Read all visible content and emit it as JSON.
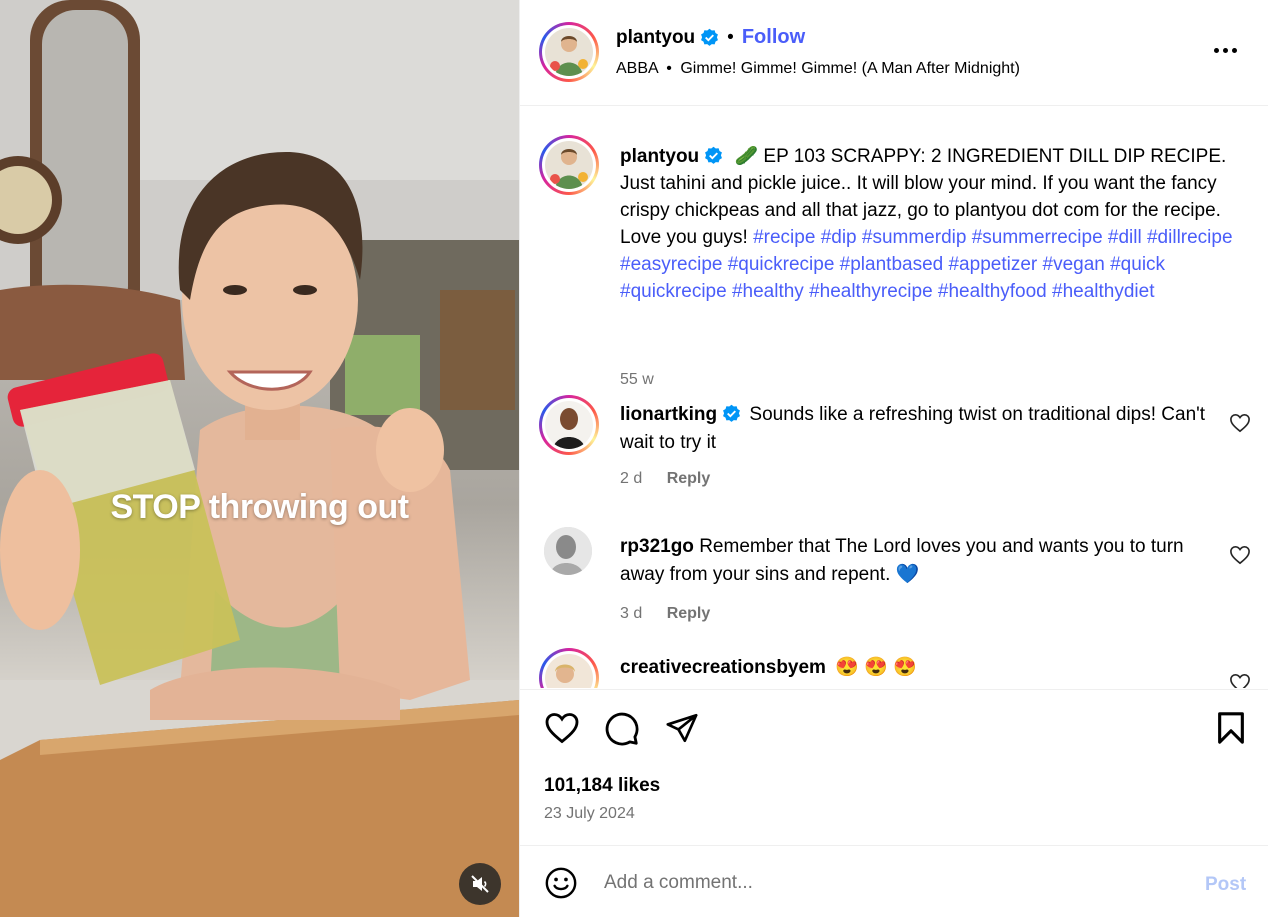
{
  "media": {
    "overlay_text": "STOP throwing out"
  },
  "header": {
    "username": "plantyou",
    "separator": "•",
    "follow_label": "Follow",
    "audio_artist": "ABBA",
    "audio_separator": "•",
    "audio_title": "Gimme! Gimme! Gimme! (A Man After Midnight)"
  },
  "caption": {
    "username": "plantyou",
    "emoji": "🥒",
    "text": "EP 103 SCRAPPY: 2 INGREDIENT DILL DIP RECIPE. Just tahini and pickle juice.. It will blow your mind. If you want the fancy crispy chickpeas and all that jazz, go to plantyou dot com for the recipe. Love you guys! ",
    "hashtags": "#recipe #dip #summerdip #summerrecipe #dill #dillrecipe #easyrecipe #quickrecipe #plantbased #appetizer #vegan #quick #quickrecipe #healthy #healthyrecipe #healthyfood #healthydiet",
    "age": "55 w"
  },
  "comments": [
    {
      "username": "lionartking",
      "verified": true,
      "text": "Sounds like a refreshing twist on traditional dips! Can't wait to try it",
      "age": "2 d",
      "reply_label": "Reply"
    },
    {
      "username": "rp321go",
      "verified": false,
      "text": "Remember that The Lord loves you and wants you to turn away from your sins and repent. 💙",
      "age": "3 d",
      "reply_label": "Reply"
    },
    {
      "username": "creativecreationsbyem",
      "verified": false,
      "text": "😍 😍 😍"
    }
  ],
  "stats": {
    "likes": "101,184 likes",
    "date": "23 July 2024"
  },
  "comment_box": {
    "placeholder": "Add a comment...",
    "post_label": "Post"
  },
  "colors": {
    "link_blue": "#4a5df9",
    "verified_blue": "#0095f6",
    "muted_gray": "#737373",
    "post_disabled": "#b3c7f7"
  }
}
